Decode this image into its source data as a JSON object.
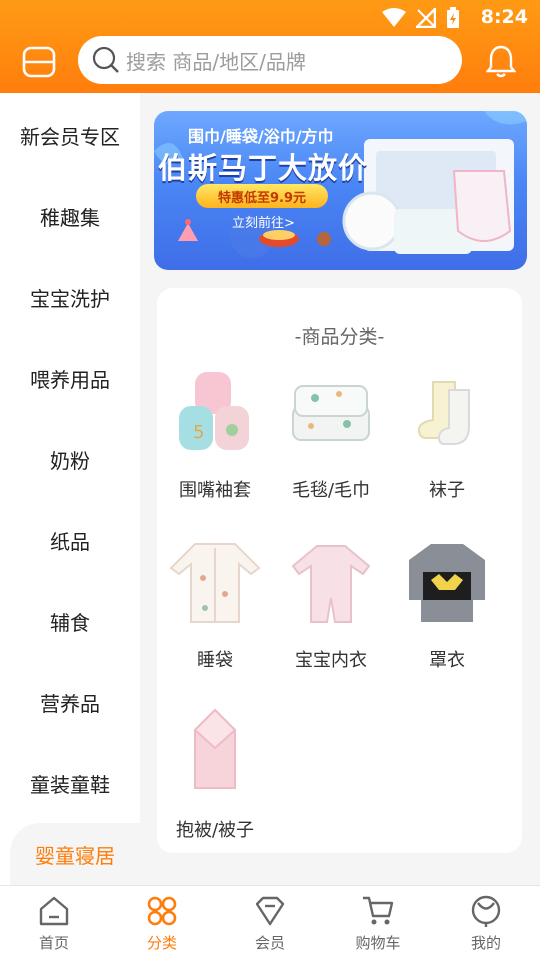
{
  "status_bar": {
    "time": "8:24"
  },
  "search": {
    "placeholder": "搜索 商品/地区/品牌"
  },
  "sidebar": {
    "items": [
      {
        "label": "新会员专区"
      },
      {
        "label": "稚趣集"
      },
      {
        "label": "宝宝洗护"
      },
      {
        "label": "喂养用品"
      },
      {
        "label": "奶粉"
      },
      {
        "label": "纸品"
      },
      {
        "label": "辅食"
      },
      {
        "label": "营养品"
      },
      {
        "label": "童装童鞋"
      },
      {
        "label": "婴童寝居"
      }
    ],
    "active_index": 9
  },
  "banner": {
    "line1": "围巾/睡袋/浴巾/方巾",
    "line2": "伯斯马丁大放价",
    "promo": "特惠低至9.9元",
    "cta": "立刻前往>"
  },
  "category_card": {
    "title": "-商品分类-",
    "items": [
      {
        "label": "围嘴袖套",
        "icon": "bib-sleeves-image"
      },
      {
        "label": "毛毯/毛巾",
        "icon": "blanket-towel-image"
      },
      {
        "label": "袜子",
        "icon": "socks-image"
      },
      {
        "label": "睡袋",
        "icon": "sleeping-bag-image"
      },
      {
        "label": "宝宝内衣",
        "icon": "baby-underwear-image"
      },
      {
        "label": "罩衣",
        "icon": "smock-image"
      },
      {
        "label": "抱被/被子",
        "icon": "swaddle-quilt-image"
      }
    ]
  },
  "tabbar": {
    "tabs": [
      {
        "label": "首页",
        "icon": "home-icon"
      },
      {
        "label": "分类",
        "icon": "category-icon"
      },
      {
        "label": "会员",
        "icon": "member-diamond-icon"
      },
      {
        "label": "购物车",
        "icon": "cart-icon"
      },
      {
        "label": "我的",
        "icon": "profile-icon"
      }
    ],
    "active_index": 1
  },
  "colors": {
    "accent": "#ff7d0c",
    "header": "#ff9a14",
    "background": "#f5f5f5"
  }
}
